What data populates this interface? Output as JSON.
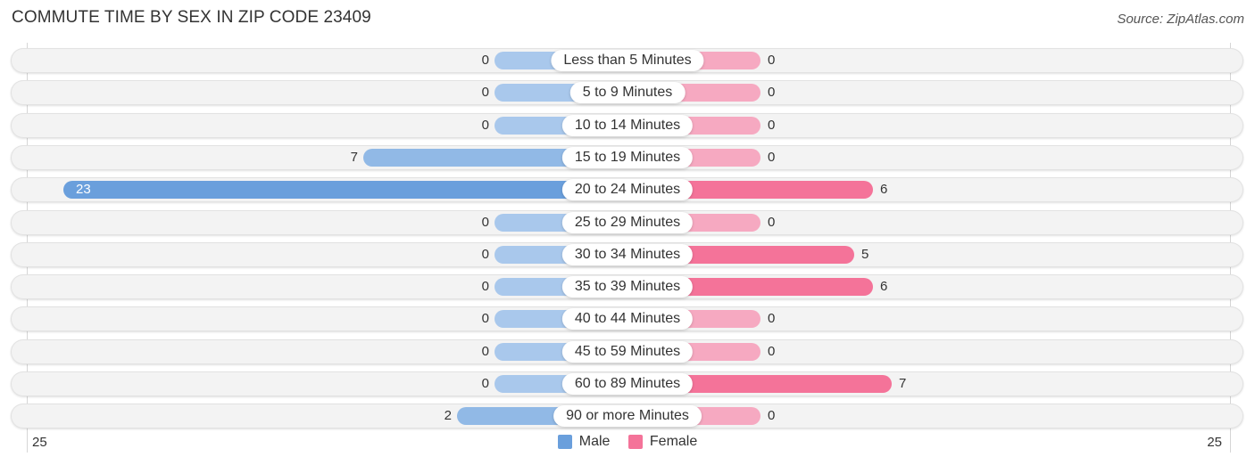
{
  "header": {
    "title": "COMMUTE TIME BY SEX IN ZIP CODE 23409",
    "source": "Source: ZipAtlas.com"
  },
  "colors": {
    "male": "#6a9fdc",
    "male_light": "#a9c8ec",
    "female": "#f47399",
    "female_light": "#f6a9c1"
  },
  "chart_data": {
    "type": "bar",
    "orientation": "horizontal-diverging",
    "title": "COMMUTE TIME BY SEX IN ZIP CODE 23409",
    "categories": [
      "Less than 5 Minutes",
      "5 to 9 Minutes",
      "10 to 14 Minutes",
      "15 to 19 Minutes",
      "20 to 24 Minutes",
      "25 to 29 Minutes",
      "30 to 34 Minutes",
      "35 to 39 Minutes",
      "40 to 44 Minutes",
      "45 to 59 Minutes",
      "60 to 89 Minutes",
      "90 or more Minutes"
    ],
    "series": [
      {
        "name": "Male",
        "side": "left",
        "values": [
          0,
          0,
          0,
          7,
          23,
          0,
          0,
          0,
          0,
          0,
          0,
          2
        ]
      },
      {
        "name": "Female",
        "side": "right",
        "values": [
          0,
          0,
          0,
          0,
          6,
          0,
          5,
          6,
          0,
          0,
          7,
          0
        ]
      }
    ],
    "axis": {
      "left_tick": "25",
      "right_tick": "25",
      "range": [
        0,
        25
      ]
    },
    "legend": {
      "position": "bottom-center",
      "entries": [
        "Male",
        "Female"
      ]
    },
    "grid": false
  }
}
